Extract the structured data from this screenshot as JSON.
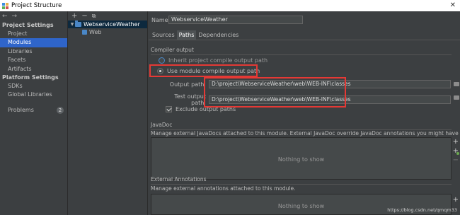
{
  "window": {
    "title": "Project Structure",
    "close_glyph": "✕"
  },
  "nav": {
    "back_icon": "←",
    "forward_icon": "→",
    "project_settings_header": "Project Settings",
    "project_settings": [
      {
        "label": "Project",
        "selected": false
      },
      {
        "label": "Modules",
        "selected": true
      },
      {
        "label": "Libraries",
        "selected": false
      },
      {
        "label": "Facets",
        "selected": false
      },
      {
        "label": "Artifacts",
        "selected": false
      }
    ],
    "platform_settings_header": "Platform Settings",
    "platform_settings": [
      {
        "label": "SDKs"
      },
      {
        "label": "Global Libraries"
      }
    ],
    "problems": {
      "label": "Problems",
      "count": "2"
    }
  },
  "tree": {
    "add_icon": "+",
    "remove_icon": "−",
    "copy_icon": "⧉",
    "expand_icon": "▼",
    "module": "WebserviceWeather",
    "facet": "Web"
  },
  "module": {
    "name_label": "Name:",
    "name_value": "WebserviceWeather",
    "tabs": [
      {
        "label": "Sources",
        "selected": false
      },
      {
        "label": "Paths",
        "selected": true
      },
      {
        "label": "Dependencies",
        "selected": false
      }
    ]
  },
  "compiler": {
    "title": "Compiler output",
    "inherit_label": "Inherit project compile output path",
    "use_module_label": "Use module compile output path",
    "selected_option": "use_module",
    "output_label": "Output path:",
    "output_value": "D:\\project\\WebserviceWeather\\web\\WEB-INF\\classes",
    "test_label": "Test output path:",
    "test_value": "D:\\project\\WebserviceWeather\\web\\WEB-INF\\classes",
    "exclude_label": "Exclude output paths",
    "exclude_checked": true
  },
  "javadoc": {
    "title": "JavaDoc",
    "description": "Manage external JavaDocs attached to this module. External JavaDoc override JavaDoc annotations you might have in your module.",
    "empty_text": "Nothing to show"
  },
  "annotations": {
    "title": "External Annotations",
    "description": "Manage external annotations attached to this module.",
    "empty_text": "Nothing to show"
  },
  "side_tools": {
    "plus": "+",
    "minus": "−"
  },
  "watermark": "https://blog.csdn.net/qmqm33",
  "colors": {
    "selection": "#2f65ca",
    "highlight": "#e53935",
    "background": "#3c3f41"
  }
}
